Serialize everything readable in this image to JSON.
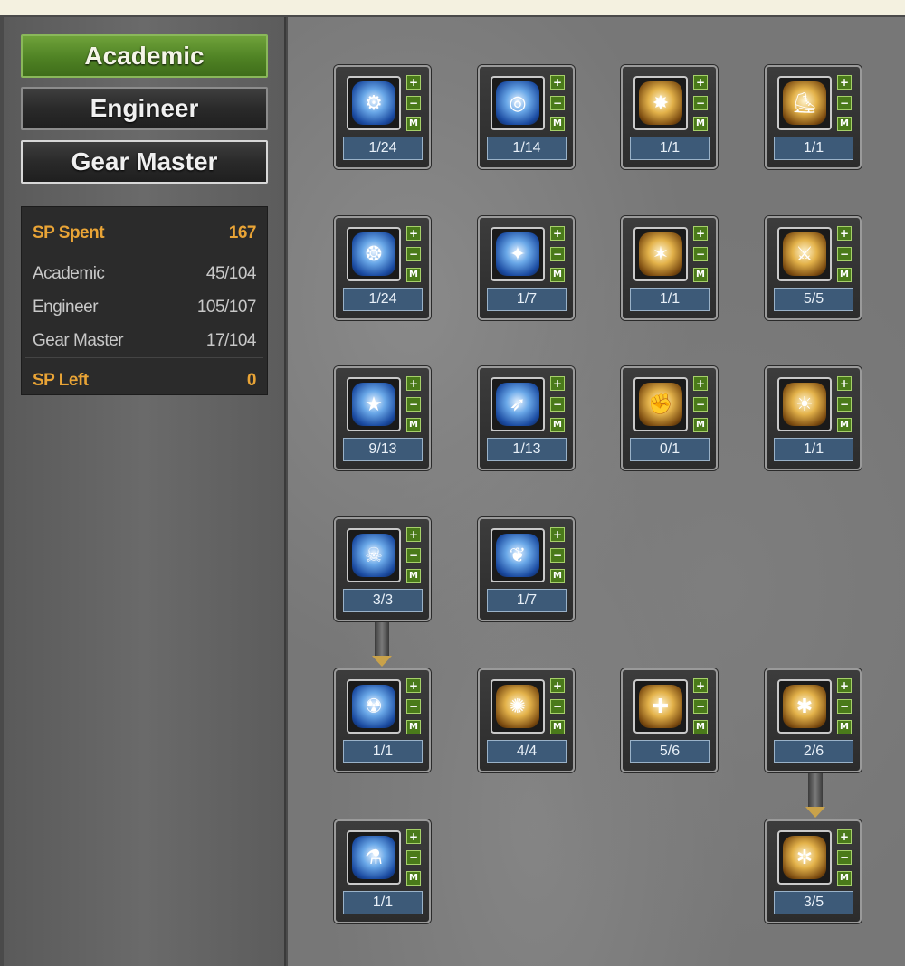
{
  "tabs": {
    "academic": "Academic",
    "engineer": "Engineer",
    "gear_master": "Gear Master"
  },
  "stats": {
    "sp_spent_label": "SP Spent",
    "sp_spent_value": "167",
    "rows": [
      {
        "label": "Academic",
        "value": "45/104"
      },
      {
        "label": "Engineer",
        "value": "105/107"
      },
      {
        "label": "Gear Master",
        "value": "17/104"
      }
    ],
    "sp_left_label": "SP Left",
    "sp_left_value": "0"
  },
  "controls": {
    "plus": "+",
    "minus": "−",
    "max": "M"
  },
  "skills": [
    {
      "icon": "gear-pills-icon",
      "glyph": "⚙",
      "color": "blue",
      "level": "1/24"
    },
    {
      "icon": "vortex-icon",
      "glyph": "◎",
      "color": "blue",
      "level": "1/14"
    },
    {
      "icon": "explosion-bird-icon",
      "glyph": "✸",
      "color": "gold",
      "level": "1/1"
    },
    {
      "icon": "boot-icon",
      "glyph": "⛸",
      "color": "gold",
      "level": "1/1"
    },
    {
      "icon": "flame-orb-icon",
      "glyph": "❂",
      "color": "blue",
      "level": "1/24"
    },
    {
      "icon": "sparkle-icon",
      "glyph": "✦",
      "color": "blue",
      "level": "1/7"
    },
    {
      "icon": "air-bird-icon",
      "glyph": "✶",
      "color": "gold",
      "level": "1/1"
    },
    {
      "icon": "crossed-sword-icon",
      "glyph": "⚔",
      "color": "gold",
      "level": "5/5"
    },
    {
      "icon": "star-orb-icon",
      "glyph": "★",
      "color": "blue",
      "level": "9/13"
    },
    {
      "icon": "running-figure-icon",
      "glyph": "➶",
      "color": "blue",
      "level": "1/13"
    },
    {
      "icon": "flexed-arm-icon",
      "glyph": "✊",
      "color": "gold",
      "level": "0/1"
    },
    {
      "icon": "glowing-figure-icon",
      "glyph": "☀",
      "color": "gold",
      "level": "1/1"
    },
    {
      "icon": "skull-icon",
      "glyph": "☠",
      "color": "blue",
      "level": "3/3"
    },
    {
      "icon": "winged-bird-icon",
      "glyph": "❦",
      "color": "blue",
      "level": "1/7"
    },
    {
      "icon": "skull-mech-icon",
      "glyph": "☢",
      "color": "blue",
      "level": "1/1"
    },
    {
      "icon": "dancing-figure-icon",
      "glyph": "✺",
      "color": "gold",
      "level": "4/4"
    },
    {
      "icon": "hp-boost-icon",
      "glyph": "✚",
      "color": "gold",
      "level": "5/6"
    },
    {
      "icon": "mp-boost-icon",
      "glyph": "✱",
      "color": "gold",
      "level": "2/6"
    },
    {
      "icon": "robot-head-icon",
      "glyph": "⚗",
      "color": "blue",
      "level": "1/1"
    },
    {
      "icon": "mp-plus-icon",
      "glyph": "✲",
      "color": "gold",
      "level": "3/5"
    }
  ]
}
